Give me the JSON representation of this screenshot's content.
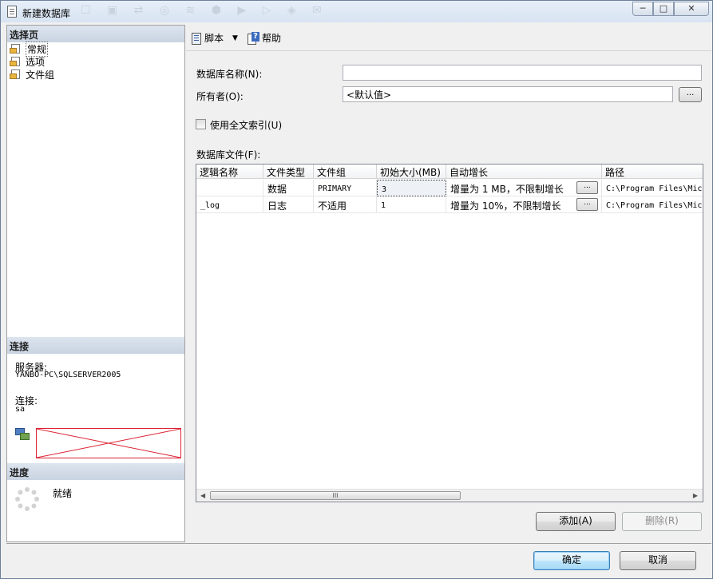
{
  "window": {
    "title": "新建数据库",
    "faded_toolbar": "☐ ▣ ⇄ ◎ ≋ ⬢ ▶ ▷ ◈ ✉",
    "buttons": {
      "minimize": "─",
      "maximize": "□",
      "close": "✕"
    }
  },
  "left": {
    "select_page_header": "选择页",
    "pages": [
      {
        "label": "常规",
        "icon": "page-settings-icon"
      },
      {
        "label": "选项",
        "icon": "page-settings-icon"
      },
      {
        "label": "文件组",
        "icon": "page-settings-icon"
      }
    ],
    "connection_header": "连接",
    "server_label": "服务器:",
    "server_value": "YANBO-PC\\SQLSERVER2005",
    "connection_label": "连接:",
    "connection_value": "sa",
    "progress_header": "进度",
    "progress_status": "就绪"
  },
  "toolbar": {
    "script_label": "脚本",
    "help_label": "帮助"
  },
  "form": {
    "db_name_label": "数据库名称(N):",
    "db_name_value": "",
    "owner_label": "所有者(O):",
    "owner_value": "<默认值>",
    "browse_label": "...",
    "fulltext_label": "使用全文索引(U)",
    "fulltext_checked": false,
    "db_files_label": "数据库文件(F):"
  },
  "grid": {
    "columns": [
      "逻辑名称",
      "文件类型",
      "文件组",
      "初始大小(MB)",
      "自动增长",
      "路径"
    ],
    "rows": [
      {
        "logical_name": "",
        "file_type": "数据",
        "filegroup": "PRIMARY",
        "initial_size": "3",
        "autogrowth": "增量为 1 MB，不限制增长",
        "autogrowth_btn": "...",
        "path": "C:\\Program Files\\Micr"
      },
      {
        "logical_name": "_log",
        "file_type": "日志",
        "filegroup": "不适用",
        "initial_size": "1",
        "autogrowth": "增量为 10%，不限制增长",
        "autogrowth_btn": "...",
        "path": "C:\\Program Files\\Micr"
      }
    ],
    "scroll_thumb": "III"
  },
  "actions": {
    "add": "添加(A)",
    "remove": "删除(R)",
    "ok": "确定",
    "cancel": "取消"
  }
}
